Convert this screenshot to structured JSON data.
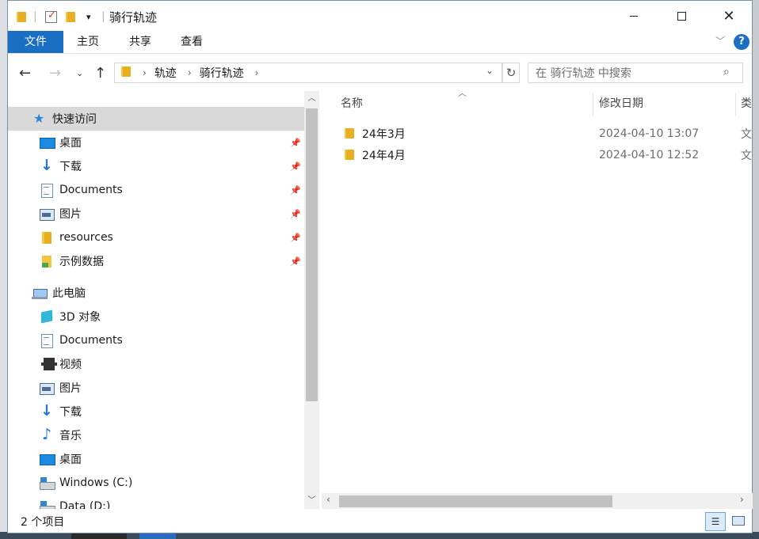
{
  "window": {
    "title": "骑行轨迹"
  },
  "ribbon": {
    "tabs": [
      "文件",
      "主页",
      "共享",
      "查看"
    ],
    "help": "?"
  },
  "nav": {
    "breadcrumb": [
      "轨迹",
      "骑行轨迹"
    ],
    "search_placeholder": "在 骑行轨迹 中搜索"
  },
  "sidebar": {
    "quick_access": "快速访问",
    "quick_items": [
      "桌面",
      "下载",
      "Documents",
      "图片",
      "resources",
      "示例数据"
    ],
    "this_pc": "此电脑",
    "pc_items": [
      "3D 对象",
      "Documents",
      "视频",
      "图片",
      "下载",
      "音乐",
      "桌面",
      "Windows (C:)",
      "Data (D:)"
    ]
  },
  "files": {
    "columns": [
      "名称",
      "修改日期",
      "类"
    ],
    "rows": [
      {
        "name": "24年3月",
        "modified": "2024-04-10 13:07",
        "type": "文"
      },
      {
        "name": "24年4月",
        "modified": "2024-04-10 12:52",
        "type": "文"
      }
    ]
  },
  "status": {
    "count": "2 个项目"
  },
  "icons": {
    "quick_items": [
      "desktop-icon",
      "download-icon",
      "document-icon",
      "picture-icon",
      "folder-icon",
      "folder-icon"
    ],
    "pc_items": [
      "cube-icon",
      "document-icon",
      "video-icon",
      "picture-icon",
      "download-icon",
      "music-icon",
      "desktop-icon",
      "drive-icon",
      "drive-icon"
    ]
  }
}
